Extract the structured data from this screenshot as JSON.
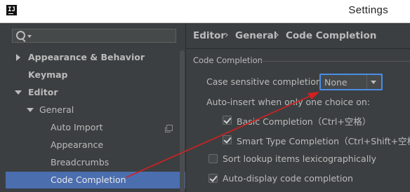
{
  "window": {
    "title": "Settings",
    "app_icon_text": "IJ"
  },
  "search": {
    "placeholder": ""
  },
  "tree": [
    {
      "label": "Appearance & Behavior",
      "state": "collapsed"
    },
    {
      "label": "Keymap"
    },
    {
      "label": "Editor",
      "state": "expanded"
    },
    {
      "label": "General",
      "state": "expanded"
    },
    {
      "label": "Auto Import"
    },
    {
      "label": "Appearance"
    },
    {
      "label": "Breadcrumbs"
    },
    {
      "label": "Code Completion",
      "selected": true
    }
  ],
  "breadcrumb": [
    "Editor",
    "General",
    "Code Completion"
  ],
  "section": {
    "title": "Code Completion",
    "case_label": "Case sensitive completion:",
    "case_value": "None",
    "auto_insert_label": "Auto-insert when only one choice on:",
    "options": [
      {
        "label": "Basic Completion（Ctrl+空格）",
        "checked": true
      },
      {
        "label": "Smart Type Completion（Ctrl+Shift+空格",
        "checked": true
      },
      {
        "label": "Sort lookup items lexicographically",
        "checked": false
      },
      {
        "label": "Auto-display code completion",
        "checked": true
      }
    ]
  },
  "colors": {
    "background": "#3c3f41",
    "selection": "#4b6eaf",
    "focus": "#4b8ee6",
    "annotation": "#d42020"
  },
  "annotation": {
    "type": "red-arrow"
  }
}
